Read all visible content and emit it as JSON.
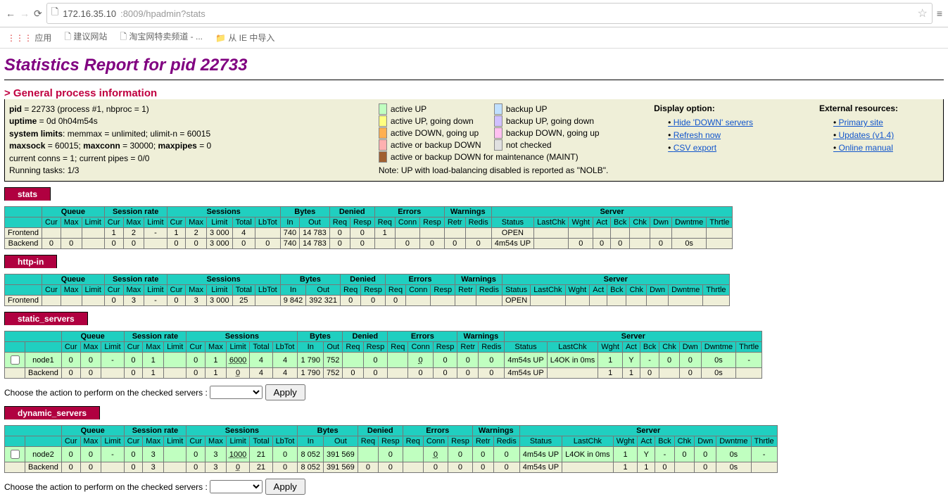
{
  "browser": {
    "url_host": "172.16.35.10",
    "url_path": ":8009/hpadmin?stats",
    "bookmarks": {
      "apps": "应用",
      "b1": "建议网站",
      "b2": "淘宝网特卖频道 - ...",
      "b3": "从 IE 中导入"
    }
  },
  "page_title": "Statistics Report for pid 22733",
  "general_heading": "> General process information",
  "process": {
    "l1a": "pid",
    "l1b": " = 22733 (process #1, nbproc = 1)",
    "l2a": "uptime",
    "l2b": " = 0d 0h04m54s",
    "l3a": "system limits",
    "l3b": ": memmax = unlimited; ulimit-n = 60015",
    "l4a": "maxsock",
    "l4b": " = 60015; ",
    "l4c": "maxconn",
    "l4d": " = 30000; ",
    "l4e": "maxpipes",
    "l4f": " = 0",
    "l5": "current conns = 1; current pipes = 0/0",
    "l6": "Running tasks: 1/3"
  },
  "legend": {
    "up": "active UP",
    "bup": "backup UP",
    "upg": "active UP, going down",
    "bupg": "backup UP, going down",
    "dng": "active DOWN, going up",
    "bdng": "backup DOWN, going up",
    "dn": "active or backup DOWN",
    "nc": "not checked",
    "maint": "active or backup DOWN for maintenance (MAINT)",
    "note": "Note: UP with load-balancing disabled is reported as \"NOLB\"."
  },
  "colors": {
    "up": "#c0ffc0",
    "upg": "#ffff80",
    "dng": "#ffb050",
    "dn": "#ffb0b0",
    "bup": "#c0e0ff",
    "bupg": "#d0c0ff",
    "bdng": "#ffc0f0",
    "nc": "#e0e0e0",
    "maint": "#a06030"
  },
  "options": {
    "display_title": "Display option:",
    "hide": "Hide 'DOWN' servers",
    "refresh": "Refresh now",
    "csv": "CSV export",
    "ext_title": "External resources:",
    "primary": "Primary site",
    "updates": "Updates (v1.4)",
    "manual": "Online manual"
  },
  "groups": [
    "",
    "Queue",
    "Session rate",
    "Sessions",
    "Bytes",
    "Denied",
    "Errors",
    "Warnings",
    "Server"
  ],
  "cols": [
    "",
    "Cur",
    "Max",
    "Limit",
    "Cur",
    "Max",
    "Limit",
    "Cur",
    "Max",
    "Limit",
    "Total",
    "LbTot",
    "In",
    "Out",
    "Req",
    "Resp",
    "Req",
    "Conn",
    "Resp",
    "Retr",
    "Redis",
    "Status",
    "LastChk",
    "Wght",
    "Act",
    "Bck",
    "Chk",
    "Dwn",
    "Dwntme",
    "Thrtle"
  ],
  "group_spans": [
    1,
    3,
    3,
    5,
    2,
    2,
    3,
    2,
    9
  ],
  "tables": {
    "stats": {
      "rows": [
        {
          "class": "cell",
          "label": "Frontend",
          "d": [
            "",
            "",
            "",
            "1",
            "2",
            "-",
            "1",
            "2",
            "3 000",
            "4",
            "",
            "740",
            "14 783",
            "0",
            "0",
            "1",
            "",
            "",
            "",
            "",
            "OPEN",
            "",
            "",
            "",
            "",
            "",
            "",
            "",
            ""
          ]
        },
        {
          "class": "cell",
          "label": "Backend",
          "d": [
            "0",
            "0",
            "",
            "0",
            "0",
            "",
            "0",
            "0",
            "3 000",
            "0",
            "0",
            "740",
            "14 783",
            "0",
            "0",
            "",
            "0",
            "0",
            "0",
            "0",
            "4m54s UP",
            "",
            "0",
            "0",
            "0",
            "",
            "0",
            "0s",
            ""
          ]
        }
      ]
    },
    "http-in": {
      "rows": [
        {
          "class": "cell",
          "label": "Frontend",
          "d": [
            "",
            "",
            "",
            "0",
            "3",
            "-",
            "0",
            "3",
            "3 000",
            "25",
            "",
            "9 842",
            "392 321",
            "0",
            "0",
            "0",
            "",
            "",
            "",
            "",
            "OPEN",
            "",
            "",
            "",
            "",
            "",
            "",
            "",
            ""
          ]
        }
      ]
    },
    "static_servers": {
      "checkable": true,
      "rows": [
        {
          "class": "up",
          "label": "node1",
          "cb": true,
          "d": [
            "0",
            "0",
            "-",
            "0",
            "1",
            "",
            "0",
            "1",
            "6000",
            "4",
            "4",
            "1 790",
            "752",
            "",
            "0",
            "",
            "0",
            "0",
            "0",
            "0",
            "4m54s UP",
            "L4OK in 0ms",
            "1",
            "Y",
            "-",
            "0",
            "0",
            "0s",
            "-"
          ],
          "dotted": [
            9,
            17
          ]
        },
        {
          "class": "cell",
          "label": "Backend",
          "d": [
            "0",
            "0",
            "",
            "0",
            "1",
            "",
            "0",
            "1",
            "0",
            "4",
            "4",
            "1 790",
            "752",
            "0",
            "0",
            "",
            "0",
            "0",
            "0",
            "0",
            "4m54s UP",
            "",
            "1",
            "1",
            "0",
            "",
            "0",
            "0s",
            ""
          ],
          "dotted": [
            9
          ]
        }
      ]
    },
    "dynamic_servers": {
      "checkable": true,
      "rows": [
        {
          "class": "up",
          "label": "node2",
          "cb": true,
          "d": [
            "0",
            "0",
            "-",
            "0",
            "3",
            "",
            "0",
            "3",
            "1000",
            "21",
            "0",
            "8 052",
            "391 569",
            "",
            "0",
            "",
            "0",
            "0",
            "0",
            "0",
            "4m54s UP",
            "L4OK in 0ms",
            "1",
            "Y",
            "-",
            "0",
            "0",
            "0s",
            "-"
          ],
          "dotted": [
            9,
            17
          ]
        },
        {
          "class": "cell",
          "label": "Backend",
          "d": [
            "0",
            "0",
            "",
            "0",
            "3",
            "",
            "0",
            "3",
            "0",
            "21",
            "0",
            "8 052",
            "391 569",
            "0",
            "0",
            "",
            "0",
            "0",
            "0",
            "0",
            "4m54s UP",
            "",
            "1",
            "1",
            "0",
            "",
            "0",
            "0s",
            ""
          ],
          "dotted": [
            9
          ]
        }
      ]
    }
  },
  "action_label": "Choose the action to perform on the checked servers :",
  "apply_label": "Apply"
}
